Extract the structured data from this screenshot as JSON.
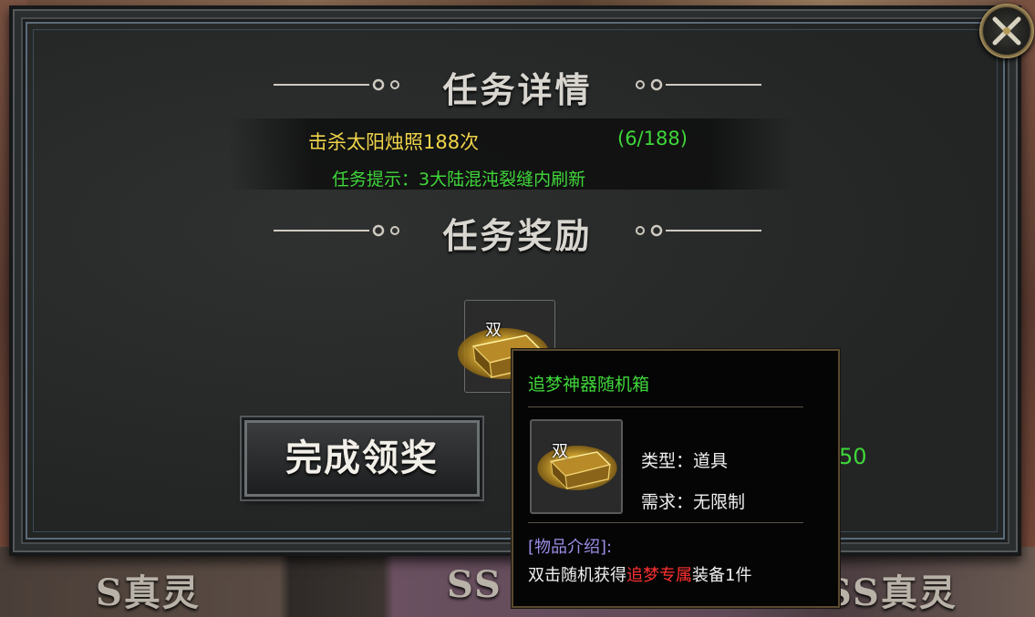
{
  "background": {
    "labels": [
      "S真灵",
      "SS",
      "SS真灵"
    ]
  },
  "panel": {
    "details_title": "任务详情",
    "task": {
      "objective": "击杀太阳烛照188次",
      "progress": "(6/188)",
      "hint": "任务提示：3大陆混沌裂缝内刷新"
    },
    "reward_title": "任务奖励",
    "reward_item": {
      "badge": "双",
      "icon": "golden-chest-icon"
    },
    "claim_button": "完成领奖",
    "partial_number": "50",
    "close_icon": "crossed-swords-close-icon"
  },
  "tooltip": {
    "title": "追梦神器随机箱",
    "icon_badge": "双",
    "type_line": "类型：道具",
    "requirement_line": "需求：无限制",
    "desc_heading": "[物品介绍]:",
    "desc_prefix": "双击随机获得",
    "desc_highlight": "追梦专属",
    "desc_suffix": "装备1件"
  },
  "colors": {
    "gold_text": "#f0d54a",
    "green_text": "#3fd63a",
    "red_highlight": "#ff3030",
    "purple_text": "#9b8de6"
  }
}
